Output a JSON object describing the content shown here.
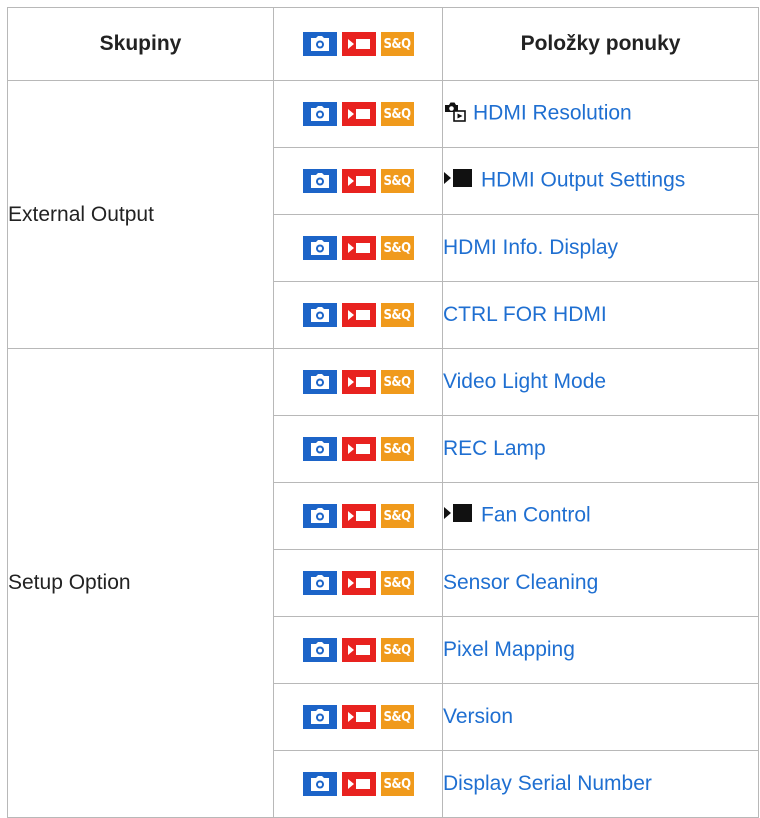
{
  "header": {
    "col_groups": "Skupiny",
    "col_items": "Položky ponuky",
    "mode_sq_label": "S&Q"
  },
  "groups": [
    {
      "name": "External Output",
      "items": [
        {
          "label": "HDMI Resolution",
          "prefix_icon": "photo-playback-icon"
        },
        {
          "label": "HDMI Output Settings",
          "prefix_icon": "movie-mode-icon"
        },
        {
          "label": "HDMI Info. Display"
        },
        {
          "label": "CTRL FOR HDMI"
        }
      ]
    },
    {
      "name": "Setup Option",
      "items": [
        {
          "label": "Video Light Mode"
        },
        {
          "label": "REC Lamp"
        },
        {
          "label": "Fan Control",
          "prefix_icon": "movie-mode-icon"
        },
        {
          "label": "Sensor Cleaning"
        },
        {
          "label": "Pixel Mapping"
        },
        {
          "label": "Version"
        },
        {
          "label": "Display Serial Number"
        }
      ]
    }
  ],
  "colors": {
    "link": "#1f6fd1",
    "photo_mode": "#1c64c8",
    "movie_mode": "#e8221f",
    "sq_mode": "#f09a1c",
    "border": "#b8b8b8"
  }
}
